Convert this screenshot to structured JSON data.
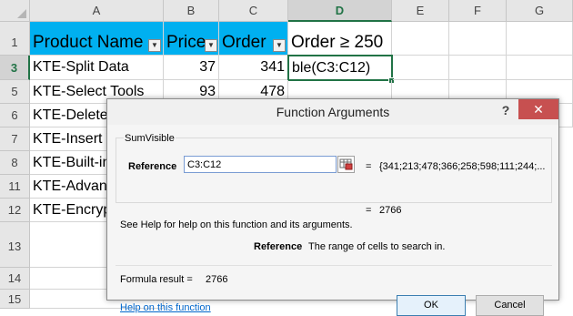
{
  "sheet": {
    "columns": [
      "A",
      "B",
      "C",
      "D",
      "E",
      "F",
      "G"
    ],
    "rows": [
      "1",
      "3",
      "5",
      "6",
      "7",
      "8",
      "11",
      "12",
      "13",
      "14",
      "15"
    ],
    "header_row": {
      "product_name": "Product Name",
      "price": "Price",
      "order": "Order",
      "criteria": "Order ≥ 250"
    },
    "data_rows": [
      {
        "row": "3",
        "name": "KTE-Split Data",
        "price": "37",
        "order": "341",
        "d": "ble(C3:C12)"
      },
      {
        "row": "5",
        "name": "KTE-Select Tools",
        "price": "93",
        "order": "478",
        "d": ""
      },
      {
        "row": "6",
        "name": "KTE-Delete T",
        "price": "",
        "order": "",
        "d": ""
      },
      {
        "row": "7",
        "name": "KTE-Insert To",
        "price": "",
        "order": "",
        "d": ""
      },
      {
        "row": "8",
        "name": "KTE-Built-in",
        "price": "",
        "order": "",
        "d": ""
      },
      {
        "row": "11",
        "name": "KTE-Advance",
        "price": "",
        "order": "",
        "d": ""
      },
      {
        "row": "12",
        "name": "KTE-Encrypt",
        "price": "",
        "order": "",
        "d": ""
      }
    ],
    "selected_column": "D",
    "selected_row": "3",
    "header_fill_color": "#00b0f0",
    "accent_color": "#217346"
  },
  "dialog": {
    "title": "Function Arguments",
    "help_glyph": "?",
    "close_glyph": "✕",
    "function_name": "SumVisible",
    "arg_label": "Reference",
    "arg_value": "C3:C12",
    "equals": "=",
    "arg_evaluated": "{341;213;478;366;258;598;111;244;...",
    "result_preview": "2766",
    "help_text": "See Help for help on this function and its arguments.",
    "arg_desc_name": "Reference",
    "arg_desc_text": "The range of cells to search in.",
    "formula_result_label": "Formula result =",
    "formula_result_value": "2766",
    "help_link": "Help on this function",
    "ok_label": "OK",
    "cancel_label": "Cancel",
    "close_color": "#c75050"
  }
}
